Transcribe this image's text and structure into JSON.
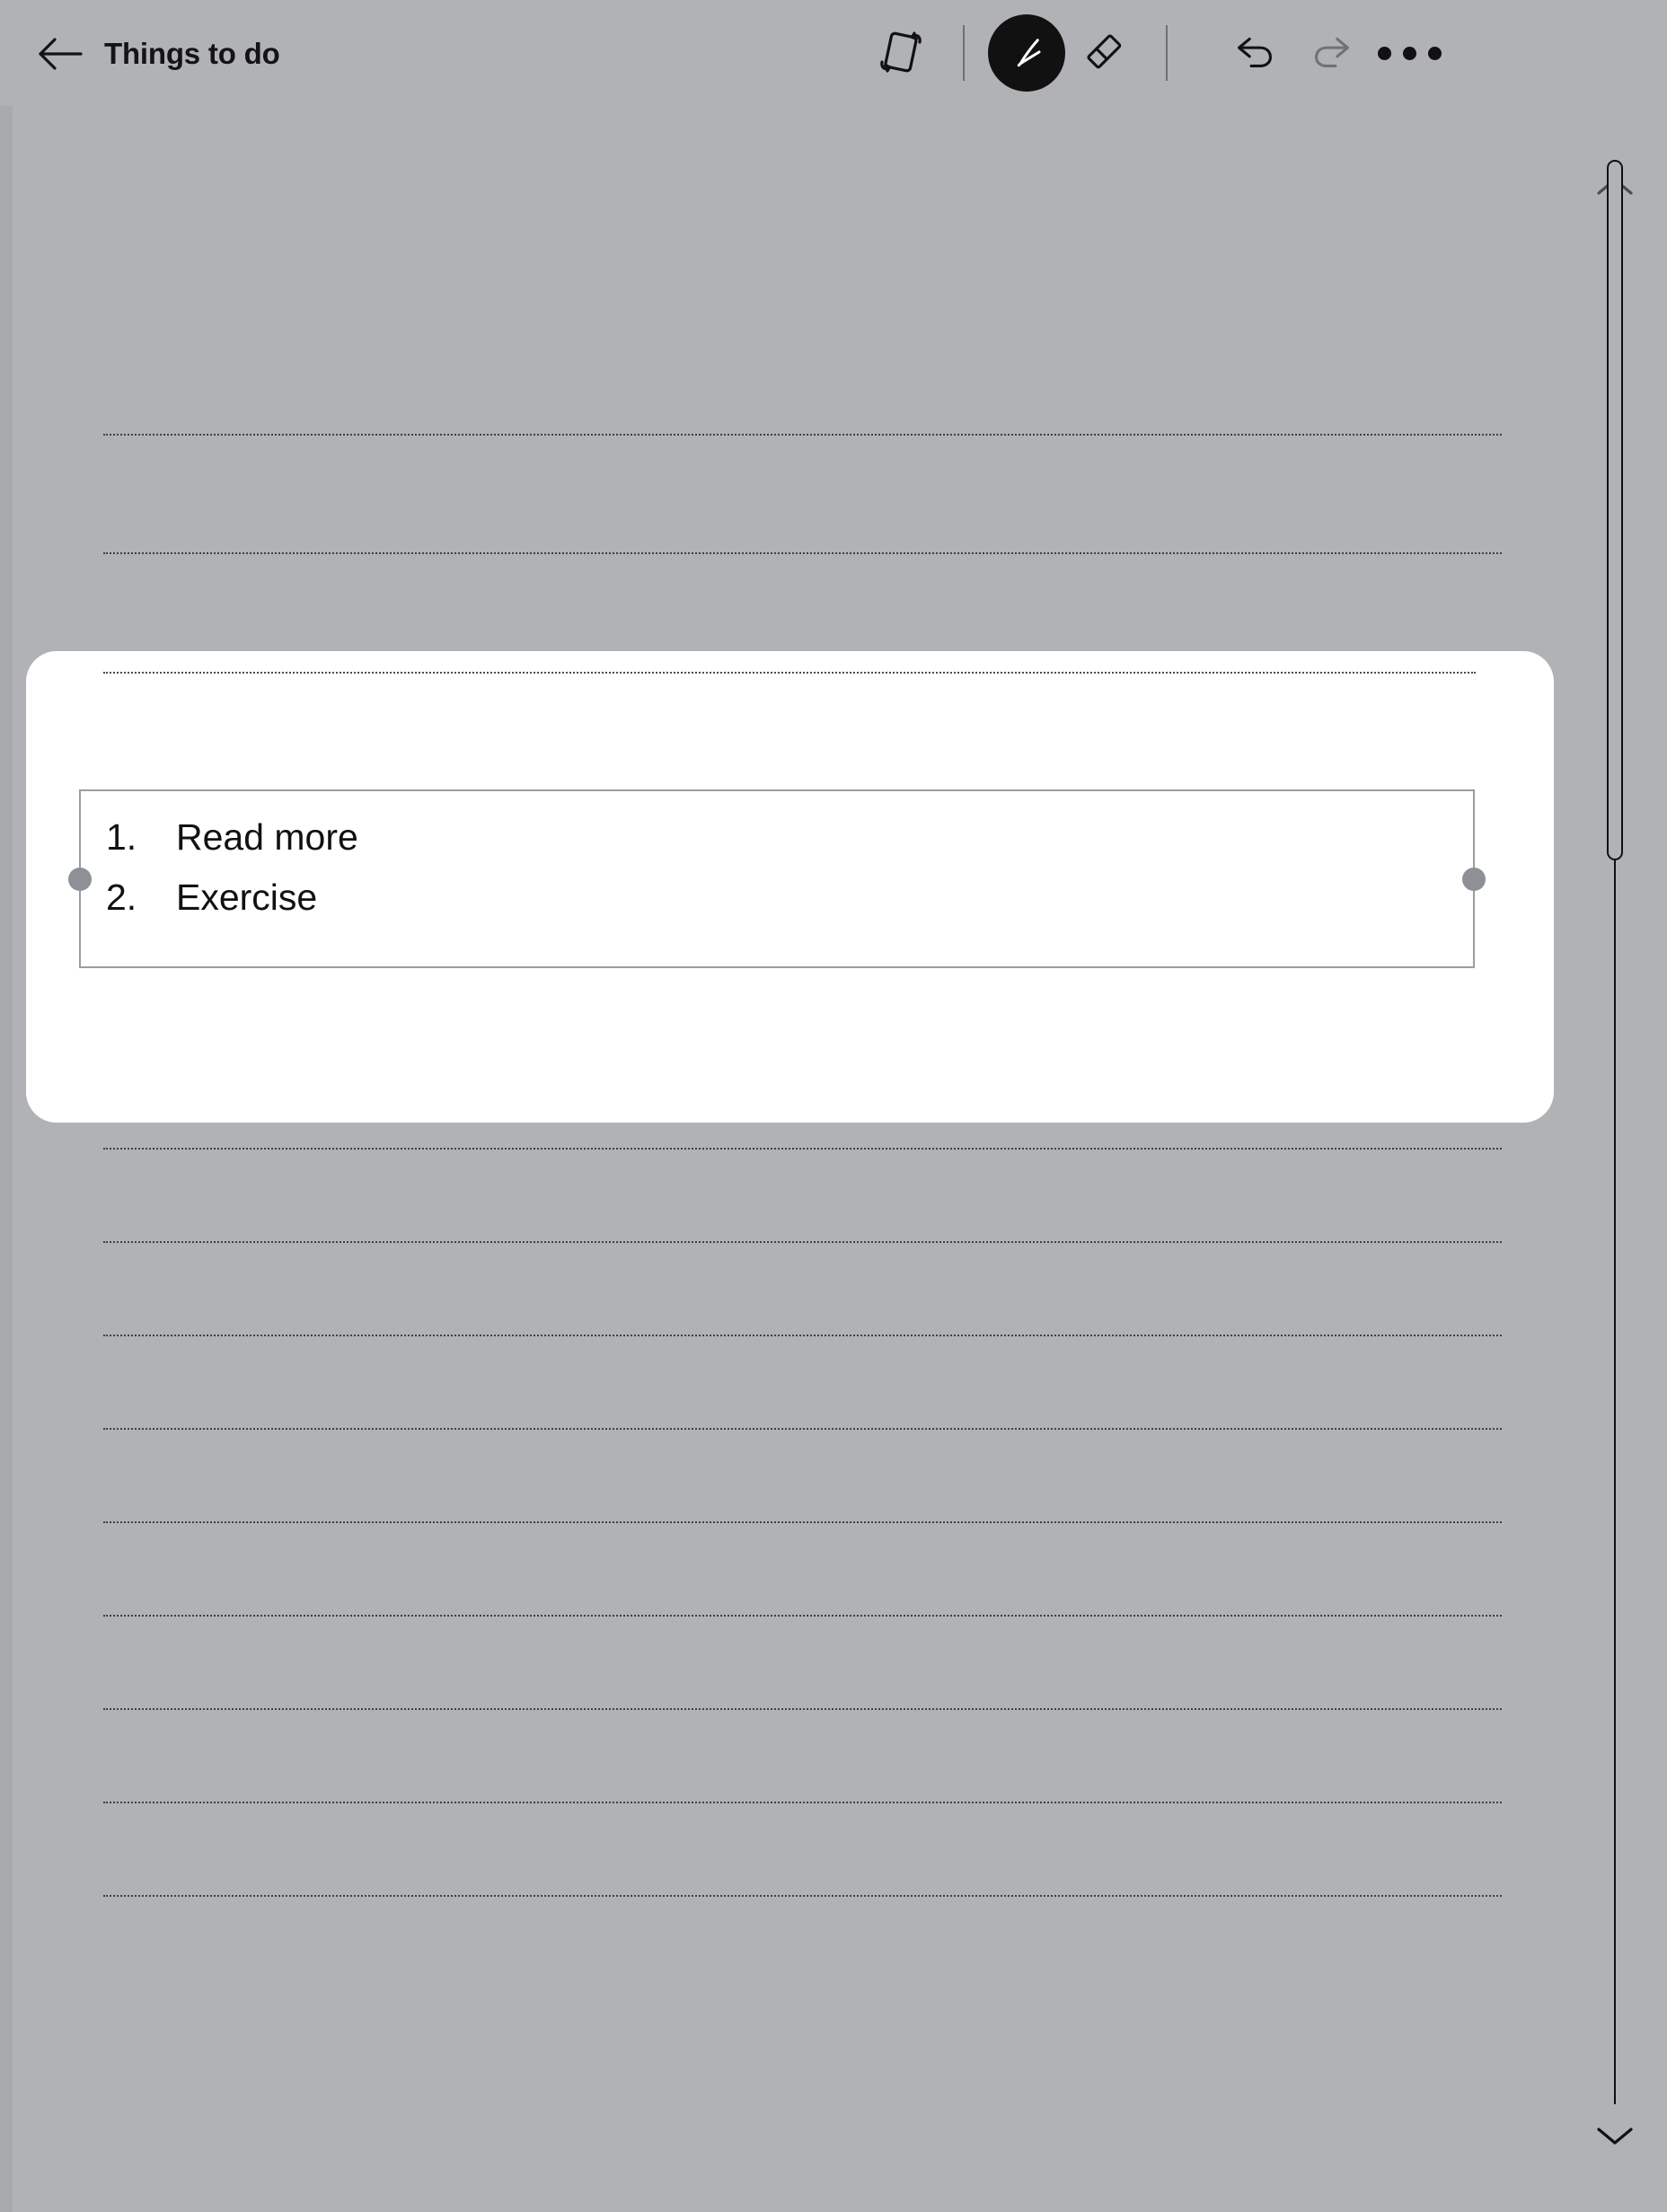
{
  "window": {
    "background_color": "#b0b2b6",
    "card_color": "#ffffff"
  },
  "topbar": {
    "back_label": "back-arrow",
    "title": "Things to do",
    "tools": [
      {
        "id": "rotate",
        "name": "rotate-page-icon",
        "label": "Rotate",
        "state": "normal"
      },
      {
        "id": "pen",
        "name": "pen-icon",
        "label": "Pen",
        "state": "selected"
      },
      {
        "id": "eraser",
        "name": "eraser-icon",
        "label": "Eraser",
        "state": "normal"
      },
      {
        "id": "undo",
        "name": "undo-icon",
        "label": "Undo",
        "state": "enabled"
      },
      {
        "id": "redo",
        "name": "redo-icon",
        "label": "Redo",
        "state": "disabled"
      },
      {
        "id": "more",
        "name": "more-options-icon",
        "label": "More",
        "state": "normal"
      }
    ]
  },
  "page": {
    "rule_line_top_positions": [
      483,
      615,
      748,
      1278,
      1382,
      1486,
      1590,
      1694,
      1798,
      1902,
      2006,
      2110
    ],
    "rule_line_style": "dotted"
  },
  "note_card": {
    "selection": {
      "handles": [
        "left",
        "right"
      ],
      "handle_color": "#8d9095",
      "border_color": "#9a9da2"
    },
    "list_items": [
      {
        "number": "1.",
        "text": "Read more"
      },
      {
        "number": "2.",
        "text": "Exercise"
      }
    ]
  },
  "scrollbar": {
    "up_label": "scroll-up",
    "down_label": "scroll-down",
    "thumb_label": "scroll-thumb"
  }
}
